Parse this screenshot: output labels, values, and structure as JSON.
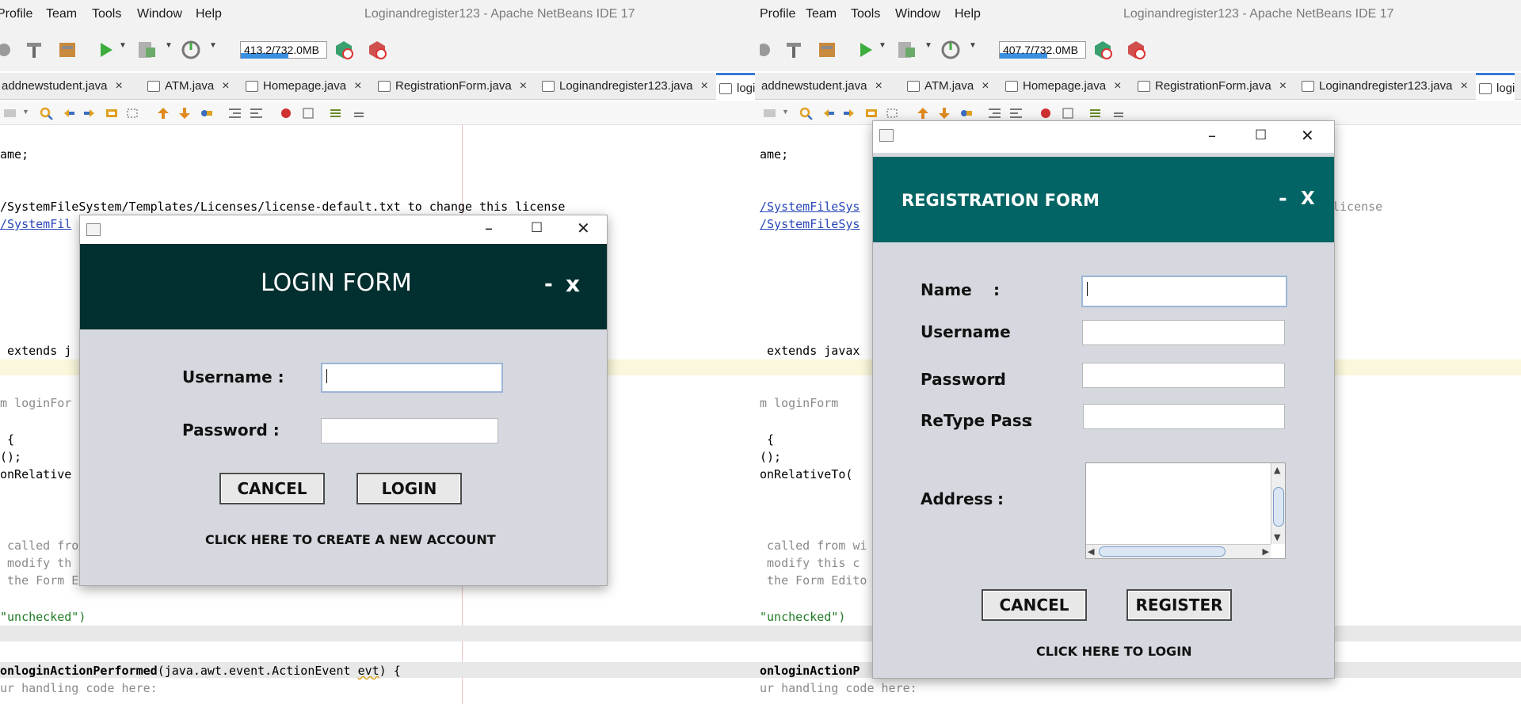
{
  "window": {
    "title": "Loginandregister123 - Apache NetBeans IDE 17",
    "menu": [
      "Profile",
      "Team",
      "Tools",
      "Window",
      "Help"
    ]
  },
  "left_pane": {
    "memory": "413.2/732.0MB",
    "memory_used_fraction": 0.56,
    "tabs": [
      "addnewstudent.java",
      "ATM.java",
      "Homepage.java",
      "RegistrationForm.java",
      "Loginandregister123.java",
      "logi"
    ]
  },
  "right_pane": {
    "memory": "407.7/732.0MB",
    "memory_used_fraction": 0.56,
    "tabs": [
      "addnewstudent.java",
      "ATM.java",
      "Homepage.java",
      "RegistrationForm.java",
      "Loginandregister123.java",
      "logi"
    ]
  },
  "code_left": {
    "l1": "ame;",
    "l2a": "/SystemFileSystem/Templates/Licenses/license-default.txt",
    "l2b": " to change this license",
    "l3": "/SystemFil",
    "l4a": " extends",
    "l4b": " j",
    "l5": "m loginFor",
    "l6": " {",
    "l7": "();",
    "l8": "onRelative",
    "l9": " called fro",
    "l10": " modify th",
    "l11": " the Form E",
    "l12": "\"unchecked\")",
    "l13a": "onloginActionPerformed",
    "l13b": "(java.awt.event.ActionEvent ",
    "l13c": "evt",
    "l13d": ") {",
    "l14": "ur handling code here:"
  },
  "code_right": {
    "l1": "ame;",
    "l2a": "/SystemFileSys",
    "l2b": "license",
    "l3": "/SystemFileSys",
    "l4a": " extends",
    "l4b": " javax",
    "l5": "m loginForm",
    "l6": " {",
    "l7": "();",
    "l8": "onRelativeTo(",
    "l9": " called from wi",
    "l10": " modify this c",
    "l11": " the Form Edito",
    "l12": "\"unchecked\")",
    "l13": "onloginActionP",
    "l14": "ur handling code here:"
  },
  "login_form": {
    "title": "LOGIN FORM",
    "minimize": "-",
    "close": "x",
    "username_label": "Username :",
    "password_label": "Password :",
    "username_value": "",
    "password_value": "",
    "cancel": "CANCEL",
    "login": "LOGIN",
    "create_link": "CLICK HERE TO CREATE A NEW ACCOUNT",
    "banner_color": "#022f2f"
  },
  "registration_form": {
    "title": "REGISTRATION FORM",
    "minimize": "-",
    "close": "X",
    "name_label": "Name",
    "username_label": "Username",
    "password_label": "Password",
    "retype_label": "ReType Pass",
    "address_label": "Address",
    "colon": ":",
    "cancel": "CANCEL",
    "register": "REGISTER",
    "login_link": "CLICK HERE TO LOGIN",
    "banner_color": "#026464"
  },
  "icons": {
    "win_minimize": "–",
    "win_maximize": "☐",
    "win_close": "✕",
    "tab_close": "×",
    "arrow_up": "▲",
    "arrow_down": "▼",
    "arrow_left": "◀",
    "arrow_right": "▶"
  }
}
